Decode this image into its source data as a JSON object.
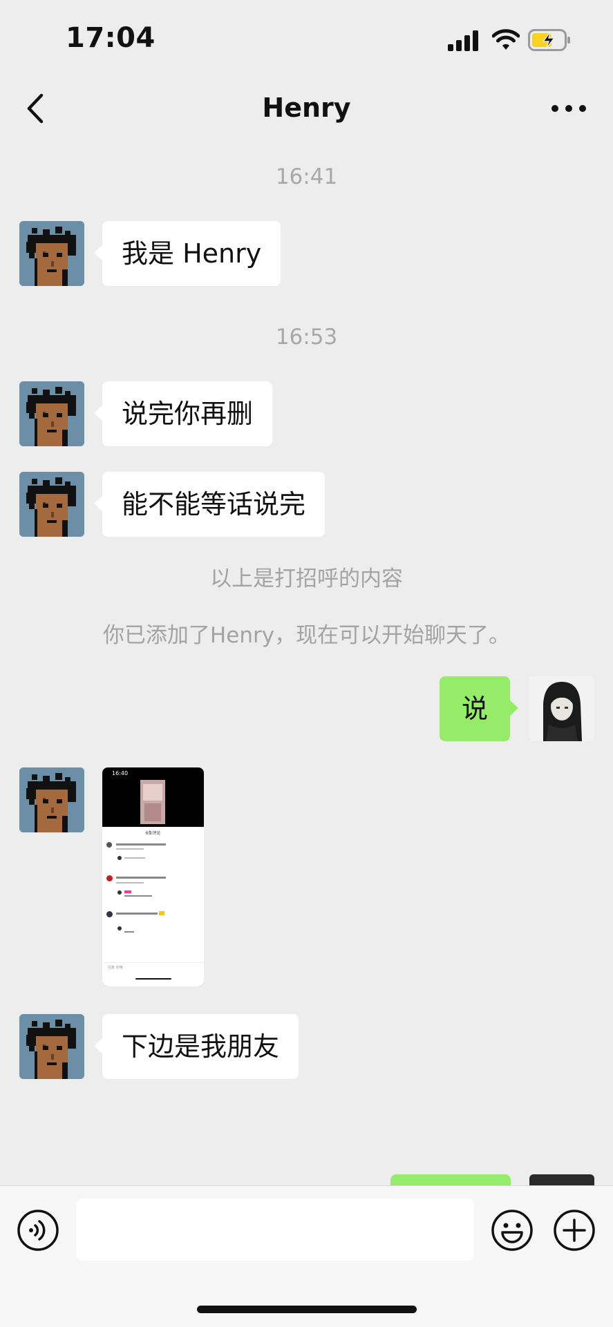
{
  "status_bar": {
    "time": "17:04"
  },
  "header": {
    "title": "Henry"
  },
  "messages": {
    "t1": "16:41",
    "m1": "我是 Henry",
    "t2": "16:53",
    "m2": "说完你再删",
    "m3": "能不能等话说完",
    "sys1": "以上是打招呼的内容",
    "sys2": "你已添加了Henry，现在可以开始聊天了。",
    "m4": "说",
    "m6": "下边是我朋友"
  },
  "image_message": {
    "time": "16:40",
    "title": "6条评论",
    "input_placeholder": "回复 你哦"
  },
  "colors": {
    "background": "#ededed",
    "bubble_incoming": "#ffffff",
    "bubble_outgoing": "#95ec69",
    "timestamp": "#a8a8a8",
    "battery_charging": "#f7d21e"
  },
  "icons": {
    "back": "chevron-left-icon",
    "more": "more-dots-icon",
    "voice": "voice-icon",
    "emoji": "emoji-icon",
    "plus": "plus-icon"
  }
}
